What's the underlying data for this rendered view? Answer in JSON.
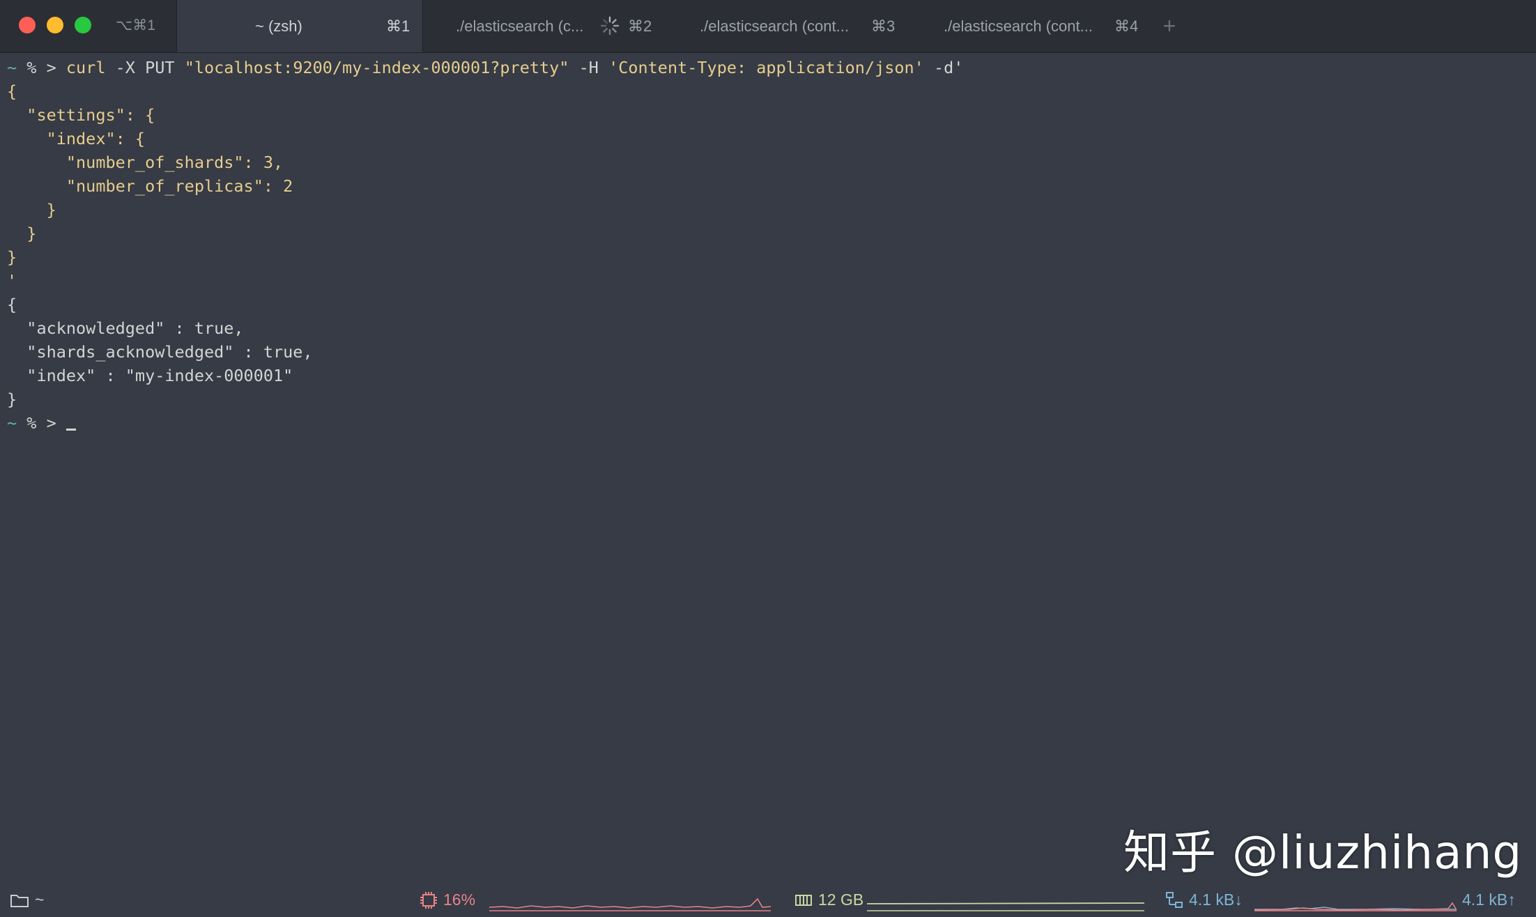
{
  "window": {
    "shortcut": "⌥⌘1",
    "colors": {
      "close": "#ff5f57",
      "minimize": "#febc2e",
      "maximize": "#28c840"
    }
  },
  "tabs": [
    {
      "title": "~ (zsh)",
      "shortcut": "⌘1",
      "active": true
    },
    {
      "title": "./elasticsearch (c...",
      "shortcut": "⌘2",
      "busy": true
    },
    {
      "title": "./elasticsearch (cont...",
      "shortcut": "⌘3"
    },
    {
      "title": "./elasticsearch (cont...",
      "shortcut": "⌘4"
    }
  ],
  "newtab_label": "+",
  "terminal": {
    "prompt_symbol": "~",
    "prompt_tail": " % > ",
    "command_name": "curl",
    "command_args": " -X PUT ",
    "command_url": "\"localhost:9200/my-index-000001?pretty\"",
    "command_header_flag": " -H ",
    "command_header": "'Content-Type: application/json'",
    "command_data_flag": " -d'",
    "body_lines": [
      "{",
      "  \"settings\": {",
      "    \"index\": {",
      "      \"number_of_shards\": 3,",
      "      \"number_of_replicas\": 2",
      "    }",
      "  }",
      "}",
      "'"
    ],
    "response_lines": [
      "{",
      "  \"acknowledged\" : true,",
      "  \"shards_acknowledged\" : true,",
      "  \"index\" : \"my-index-000001\"",
      "}"
    ]
  },
  "watermark": "知乎 @liuzhihang",
  "statusbar": {
    "cwd": "~",
    "cpu": "16%",
    "memory": "12 GB",
    "net_down": "4.1 kB↓",
    "net_up": "4.1 kB↑",
    "colors": {
      "cpu": "#e88388",
      "memory": "#c5d9a4",
      "network": "#7fb4d6"
    }
  }
}
